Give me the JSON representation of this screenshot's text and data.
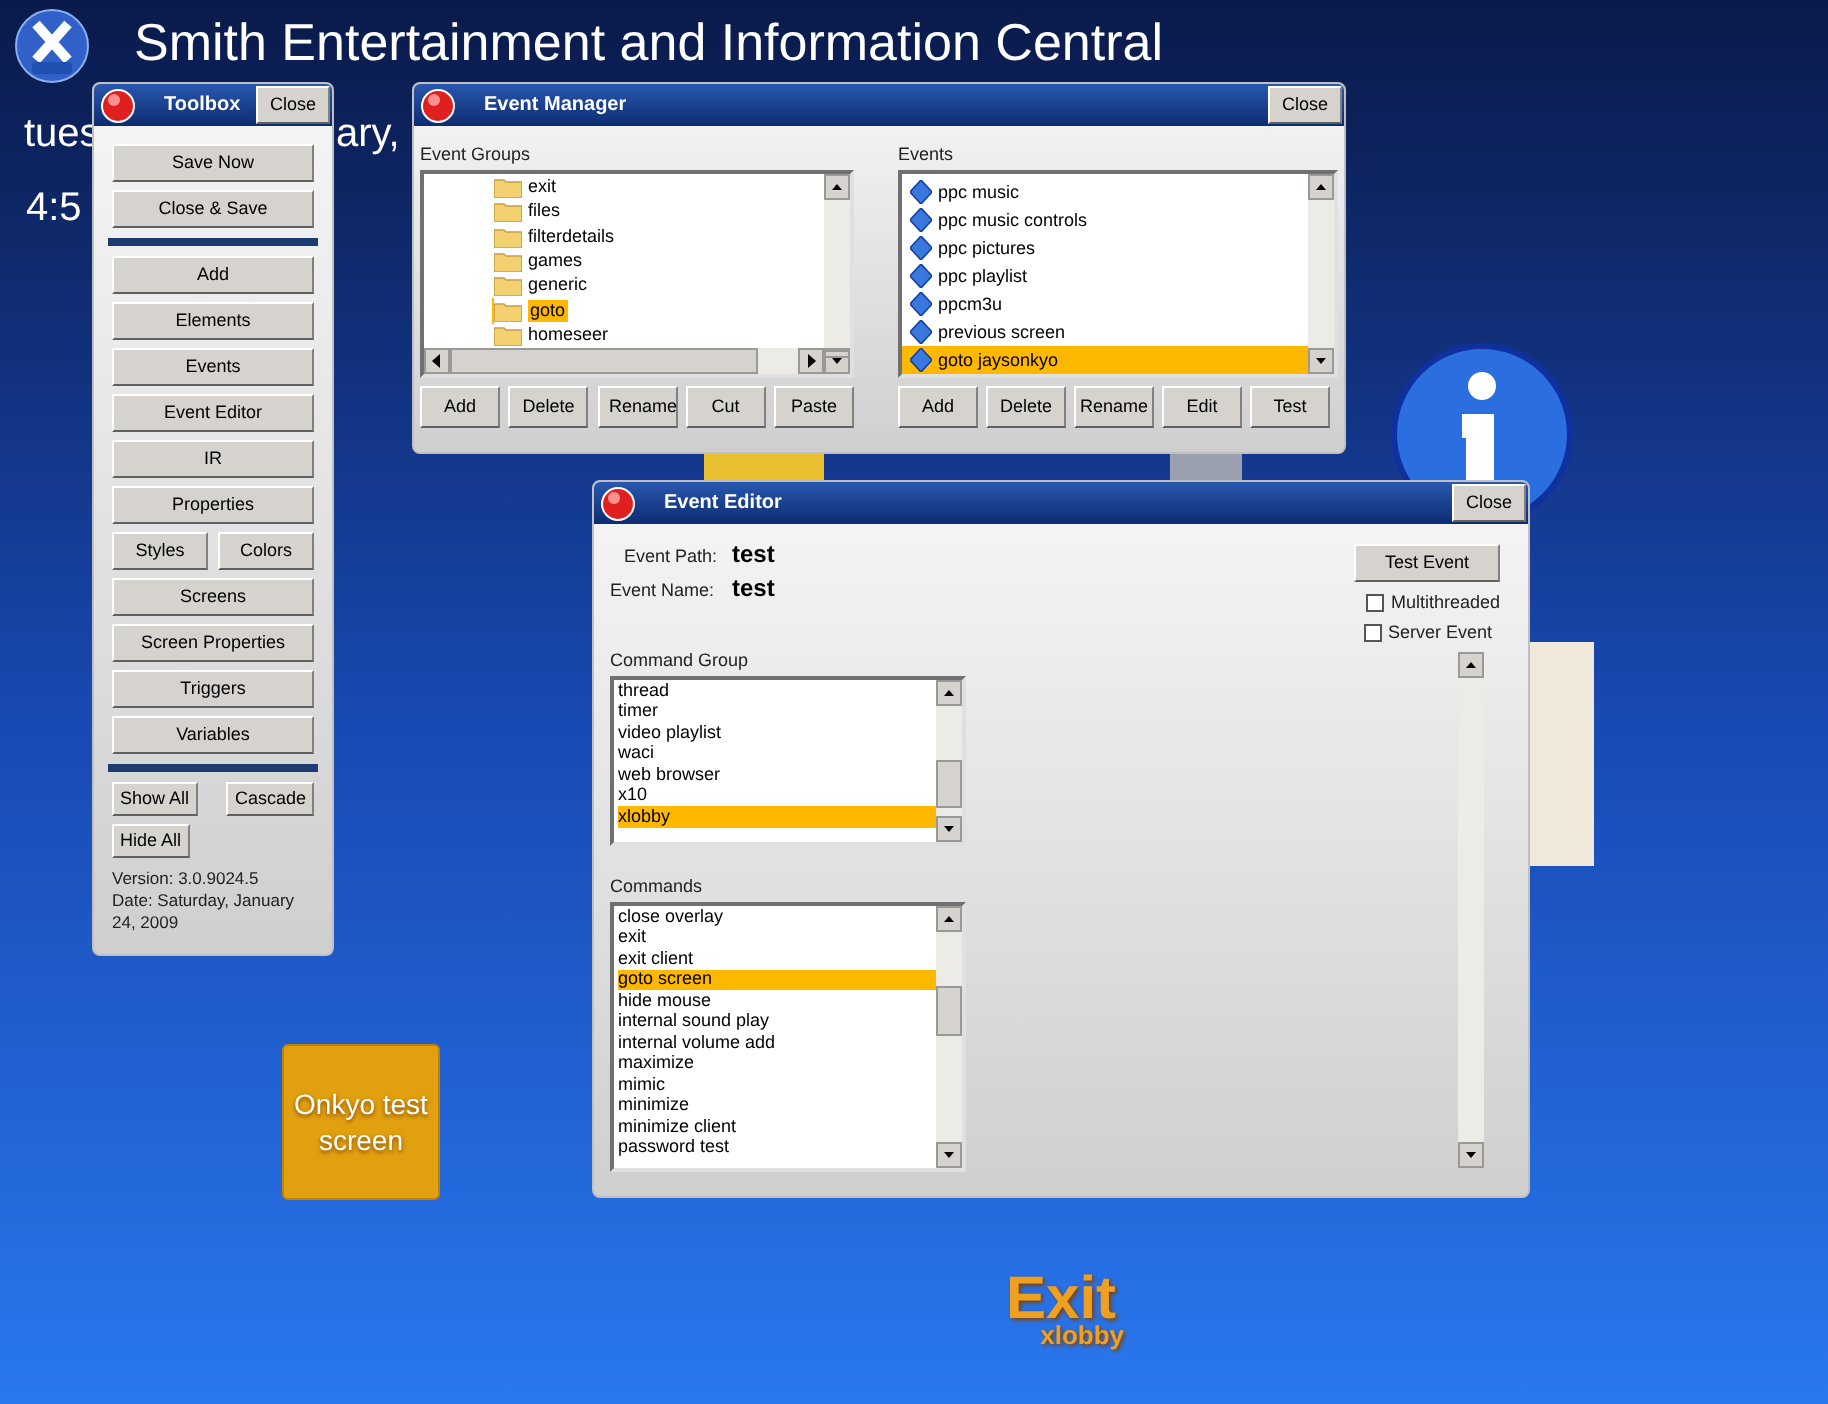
{
  "app_title": "Smith Entertainment and Information Central",
  "background_texts": [
    "tues",
    "ary,",
    "4:5"
  ],
  "toolbox": {
    "title": "Toolbox",
    "close": "Close",
    "button_groups": [
      [
        [
          "Save Now"
        ],
        [
          "Close & Save"
        ]
      ],
      [
        [
          "Add"
        ],
        [
          "Elements"
        ],
        [
          "Events"
        ],
        [
          "Event Editor"
        ],
        [
          "IR"
        ],
        [
          "Properties"
        ],
        [
          "Styles",
          "Colors"
        ],
        [
          "Screens"
        ],
        [
          "Screen Properties"
        ],
        [
          "Triggers"
        ],
        [
          "Variables"
        ]
      ],
      [
        [
          "Show All",
          "Cascade"
        ],
        [
          "Hide All"
        ]
      ]
    ],
    "version_info": [
      "Version: 3.0.9024.5",
      "Date: Saturday, January 24, 2009"
    ]
  },
  "event_manager": {
    "title": "Event Manager",
    "close": "Close",
    "groups": {
      "label": "Event Groups",
      "items": [
        {
          "label": "exit",
          "selected": false
        },
        {
          "label": "files",
          "selected": false
        },
        {
          "label": "filterdetails",
          "selected": false
        },
        {
          "label": "games",
          "selected": false
        },
        {
          "label": "generic",
          "selected": false
        },
        {
          "label": "goto",
          "selected": true
        },
        {
          "label": "homeseer",
          "selected": false
        }
      ],
      "buttons": [
        "Add",
        "Delete",
        "Rename",
        "Cut",
        "Paste"
      ]
    },
    "events": {
      "label": "Events",
      "items": [
        {
          "label": "ppc music",
          "selected": false
        },
        {
          "label": "ppc music controls",
          "selected": false
        },
        {
          "label": "ppc pictures",
          "selected": false
        },
        {
          "label": "ppc playlist",
          "selected": false
        },
        {
          "label": "ppcm3u",
          "selected": false
        },
        {
          "label": "previous screen",
          "selected": false
        },
        {
          "label": "goto jaysonkyo",
          "selected": true
        }
      ],
      "buttons": [
        "Add",
        "Delete",
        "Rename",
        "Edit",
        "Test"
      ]
    }
  },
  "event_editor": {
    "title": "Event Editor",
    "close": "Close",
    "fields": [
      {
        "label": "Event Path:",
        "value": "test"
      },
      {
        "label": "Event Name:",
        "value": "test"
      }
    ],
    "test_button": "Test Event",
    "checkboxes": [
      {
        "label": "Multithreaded",
        "checked": false
      },
      {
        "label": "Server Event",
        "checked": false
      }
    ],
    "command_group": {
      "label": "Command Group",
      "items": [
        {
          "label": "thread",
          "selected": false
        },
        {
          "label": "timer",
          "selected": false
        },
        {
          "label": "video playlist",
          "selected": false
        },
        {
          "label": "waci",
          "selected": false
        },
        {
          "label": "web browser",
          "selected": false
        },
        {
          "label": "x10",
          "selected": false
        },
        {
          "label": "xlobby",
          "selected": true
        }
      ]
    },
    "commands": {
      "label": "Commands",
      "items": [
        {
          "label": "close overlay",
          "selected": false
        },
        {
          "label": "exit",
          "selected": false
        },
        {
          "label": "exit client",
          "selected": false
        },
        {
          "label": "goto screen",
          "selected": true
        },
        {
          "label": "hide mouse",
          "selected": false
        },
        {
          "label": "internal sound play",
          "selected": false
        },
        {
          "label": "internal volume add",
          "selected": false
        },
        {
          "label": "maximize",
          "selected": false
        },
        {
          "label": "mimic",
          "selected": false
        },
        {
          "label": "minimize",
          "selected": false
        },
        {
          "label": "minimize client",
          "selected": false
        },
        {
          "label": "password test",
          "selected": false
        }
      ]
    }
  },
  "desktop_button": "Onkyo test screen",
  "exit_logo": {
    "main": "Exit",
    "sub": "xlobby"
  }
}
